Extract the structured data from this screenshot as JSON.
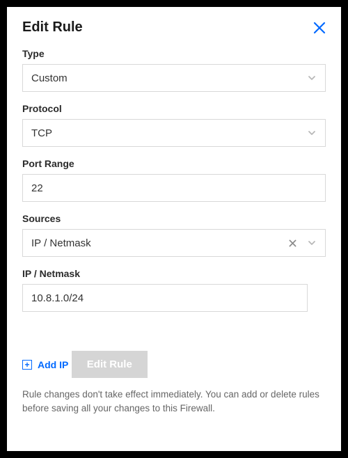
{
  "header": {
    "title": "Edit Rule"
  },
  "fields": {
    "type": {
      "label": "Type",
      "value": "Custom"
    },
    "protocol": {
      "label": "Protocol",
      "value": "TCP"
    },
    "port_range": {
      "label": "Port Range",
      "value": "22"
    },
    "sources": {
      "label": "Sources",
      "value": "IP / Netmask"
    },
    "ip_netmask": {
      "label": "IP / Netmask",
      "value": "10.8.1.0/24"
    }
  },
  "add_ip_label": "Add IP",
  "submit_label": "Edit Rule",
  "note_text": "Rule changes don't take effect immediately. You can add or delete rules before saving all your changes to this Firewall."
}
